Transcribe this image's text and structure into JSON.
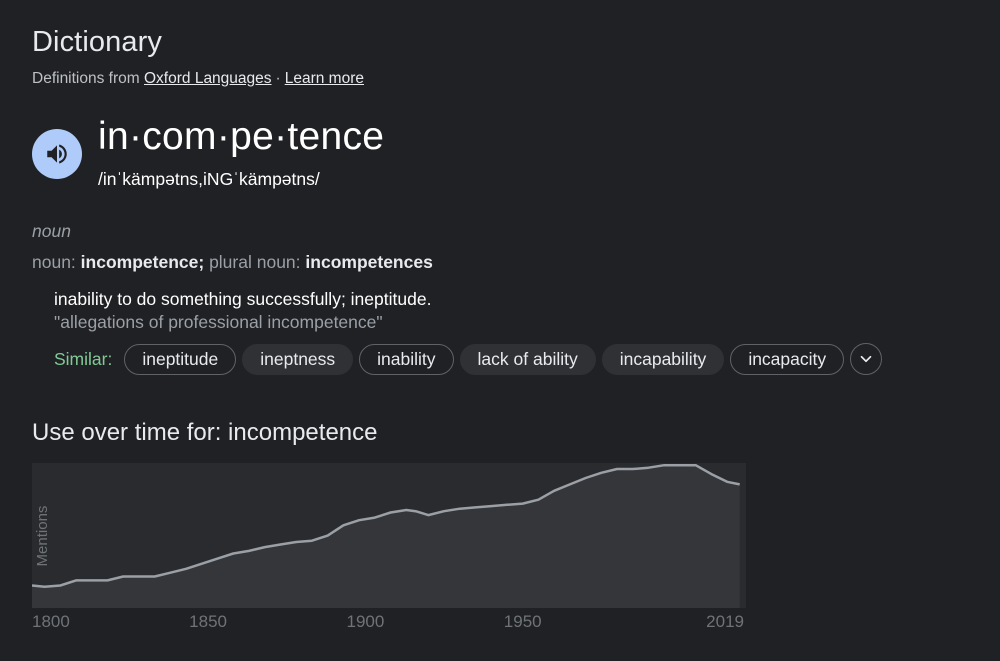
{
  "header": {
    "title": "Dictionary",
    "source_prefix": "Definitions from",
    "source_link": "Oxford Languages",
    "separator": "·",
    "learn_more": "Learn more"
  },
  "entry": {
    "word": "in·com·pe·tence",
    "phonetic": "/inˈkämpətns,iNGˈkämpətns/",
    "part_of_speech": "noun",
    "forms": {
      "noun_label": "noun:",
      "noun_value": "incompetence",
      "divider": ";",
      "plural_label": "plural noun:",
      "plural_value": "incompetences"
    },
    "definition": "inability to do something successfully; ineptitude.",
    "example": "\"allegations of professional incompetence\"",
    "similar_label": "Similar:",
    "similar": [
      "ineptitude",
      "ineptness",
      "inability",
      "lack of ability",
      "incapability",
      "incapacity"
    ]
  },
  "icons": {
    "speaker": "volume-up-icon",
    "expand": "chevron-down-icon"
  },
  "colors": {
    "background": "#202124",
    "speaker_bg": "#aecbfa",
    "similar_label": "#81c995",
    "chart_bg": "#2a2b2e",
    "chart_line": "#9aa0a6"
  },
  "usage": {
    "title": "Use over time for: incompetence"
  },
  "chart_data": {
    "type": "area",
    "title": "",
    "ylabel": "Mentions",
    "xlabel": "",
    "x_ticks": [
      "1800",
      "1850",
      "1900",
      "1950",
      "2019"
    ],
    "xlim": [
      1794,
      2021
    ],
    "ylim": [
      0,
      1
    ],
    "grid": false,
    "x": [
      1794,
      1798,
      1803,
      1808,
      1813,
      1818,
      1823,
      1828,
      1833,
      1838,
      1843,
      1848,
      1853,
      1858,
      1863,
      1868,
      1873,
      1878,
      1883,
      1888,
      1893,
      1898,
      1903,
      1908,
      1913,
      1916,
      1920,
      1925,
      1930,
      1935,
      1940,
      1945,
      1950,
      1955,
      1960,
      1965,
      1970,
      1975,
      1980,
      1985,
      1990,
      1995,
      2000,
      2005,
      2010,
      2015,
      2019
    ],
    "y": [
      0.09,
      0.08,
      0.09,
      0.13,
      0.13,
      0.13,
      0.16,
      0.16,
      0.16,
      0.19,
      0.22,
      0.26,
      0.3,
      0.34,
      0.36,
      0.39,
      0.41,
      0.43,
      0.44,
      0.48,
      0.56,
      0.6,
      0.62,
      0.66,
      0.68,
      0.67,
      0.64,
      0.67,
      0.69,
      0.7,
      0.71,
      0.72,
      0.73,
      0.76,
      0.83,
      0.88,
      0.93,
      0.97,
      1.0,
      1.0,
      1.01,
      1.03,
      1.03,
      1.03,
      0.96,
      0.9,
      0.88
    ]
  }
}
